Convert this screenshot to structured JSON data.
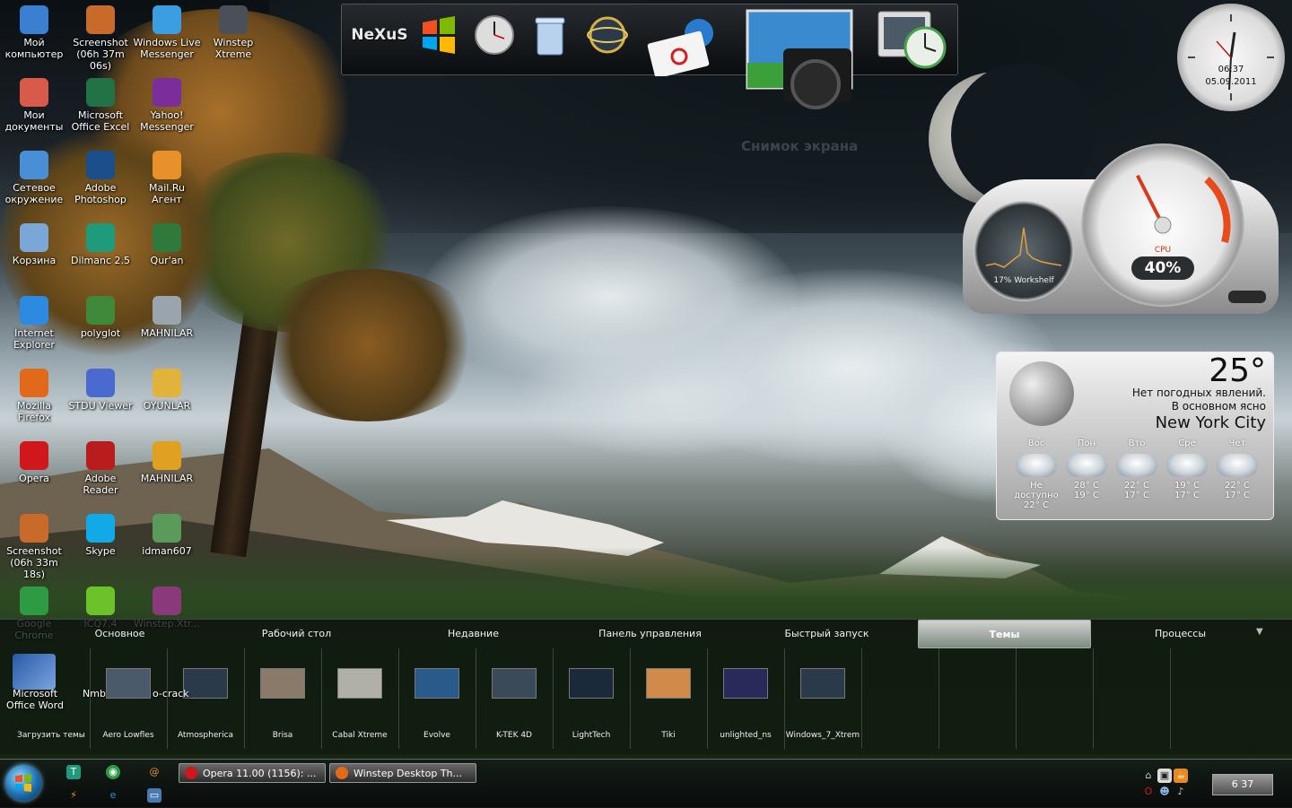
{
  "desktop_icons": [
    {
      "label": "Мой компьютер",
      "icon": "computer-icon",
      "color": "#3b7fd0"
    },
    {
      "label": "Screenshot (06h 37m 06s)",
      "icon": "image-icon",
      "color": "#c86a2a"
    },
    {
      "label": "Windows Live Messenger",
      "icon": "messenger-icon",
      "color": "#3a9ee0"
    },
    {
      "label": "Winstep Xtreme",
      "icon": "winstep-icon",
      "color": "#4a4f58"
    },
    {
      "label": "Мои документы",
      "icon": "folder-icon",
      "color": "#d85a4a"
    },
    {
      "label": "Microsoft Office Excel",
      "icon": "excel-icon",
      "color": "#217346"
    },
    {
      "label": "Yahoo! Messenger",
      "icon": "yahoo-icon",
      "color": "#7b2d9c"
    },
    {
      "label": "Сетевое окружение",
      "icon": "network-icon",
      "color": "#4a8fd6"
    },
    {
      "label": "Adobe Photoshop",
      "icon": "photoshop-icon",
      "color": "#1a4f8c"
    },
    {
      "label": "Mail.Ru Агент",
      "icon": "mail-agent-icon",
      "color": "#e8902a"
    },
    {
      "label": "Корзина",
      "icon": "recycle-bin-icon",
      "color": "#7aa6d8"
    },
    {
      "label": "Dilmanc 2.5",
      "icon": "dilmanc-icon",
      "color": "#1f9a7a"
    },
    {
      "label": "Qur'an",
      "icon": "book-icon",
      "color": "#2f7a3a"
    },
    {
      "label": "Internet Explorer",
      "icon": "ie-icon",
      "color": "#2c8be0"
    },
    {
      "label": "polyglot",
      "icon": "polyglot-icon",
      "color": "#3f8a3a"
    },
    {
      "label": "MAHNILAR",
      "icon": "cd-icon",
      "color": "#9aa4ad"
    },
    {
      "label": "Mozilla Firefox",
      "icon": "firefox-icon",
      "color": "#e06a1a"
    },
    {
      "label": "STDU Viewer",
      "icon": "stdu-icon",
      "color": "#4a6ad0"
    },
    {
      "label": "OYUNLAR",
      "icon": "folder-icon",
      "color": "#e2b33a"
    },
    {
      "label": "Opera",
      "icon": "opera-icon",
      "color": "#d0181c"
    },
    {
      "label": "Adobe Reader",
      "icon": "reader-icon",
      "color": "#b81c1c"
    },
    {
      "label": "MAHNILAR",
      "icon": "winamp-icon",
      "color": "#e0a020"
    },
    {
      "label": "Screenshot (06h 33m 18s)",
      "icon": "image-icon",
      "color": "#c86a2a"
    },
    {
      "label": "Skype",
      "icon": "skype-icon",
      "color": "#12a9e8"
    },
    {
      "label": "idman607",
      "icon": "installer-icon",
      "color": "#5a9a5a"
    },
    {
      "label": "Google Chrome",
      "icon": "chrome-icon",
      "color": "#2f9a44"
    },
    {
      "label": "ICQ7.4",
      "icon": "icq-icon",
      "color": "#6cc22a"
    },
    {
      "label": "Winstep.Xtr...",
      "icon": "archive-icon",
      "color": "#8a3a7a"
    }
  ],
  "top_dock": {
    "items": [
      {
        "name": "nexus-icon",
        "glyph": "NeXuS"
      },
      {
        "name": "windows-logo-icon",
        "glyph": "❖"
      },
      {
        "name": "clock-icon",
        "glyph": "◷"
      },
      {
        "name": "recycle-bin-icon",
        "glyph": "🗑"
      },
      {
        "name": "globe-network-icon",
        "glyph": "◎"
      },
      {
        "name": "email-icon",
        "glyph": "✉"
      },
      {
        "name": "screenshot-camera-icon",
        "glyph": "📷"
      },
      {
        "name": "monitor-clock-icon",
        "glyph": "🖥"
      }
    ],
    "hover_label": "Снимок экрана"
  },
  "clock_gadget": {
    "time": "06:37",
    "date": "05.09.2011"
  },
  "cpu_meter": {
    "label": "CPU",
    "value": "40%",
    "small_label": "17% Workshelf",
    "cpu_percent": 40
  },
  "weather": {
    "temperature": "25°",
    "condition_line1": "Нет погодных явлений.",
    "condition_line2": "В основном ясно",
    "city": "New York City",
    "forecast": [
      {
        "day": "Вос",
        "high": "Не доступно",
        "low": "22° C"
      },
      {
        "day": "Пон",
        "high": "28° C",
        "low": "19° C"
      },
      {
        "day": "Вто",
        "high": "22° C",
        "low": "17° C"
      },
      {
        "day": "Сре",
        "high": "19° C",
        "low": "17° C"
      },
      {
        "day": "Чет",
        "high": "22° C",
        "low": "17° C"
      }
    ]
  },
  "launcher": {
    "tabs": [
      "Основное",
      "Рабочий стол",
      "Недавние",
      "Панель управления",
      "Быстрый запуск",
      "Темы",
      "Процессы"
    ],
    "active_tab": "Темы",
    "left_overlay_icon": {
      "label": "Microsoft Office Word"
    },
    "left_overlay_texts": [
      "Nmb",
      "o-crack"
    ],
    "themes": [
      "Загрузить темы",
      "Aero Lowfles",
      "Atmospherica",
      "Brisa",
      "Cabal Xtreme",
      "Evolve",
      "K-TEK 4D",
      "LightTech",
      "Tiki",
      "unlighted_ns",
      "Windows_7_Xtrem"
    ]
  },
  "taskbar": {
    "tasks": [
      {
        "label": "Opera 11.00 (1156): ...",
        "icon": "opera-icon"
      },
      {
        "label": "Winstep Desktop Th...",
        "icon": "firefox-icon"
      }
    ],
    "clock": "6 37"
  }
}
